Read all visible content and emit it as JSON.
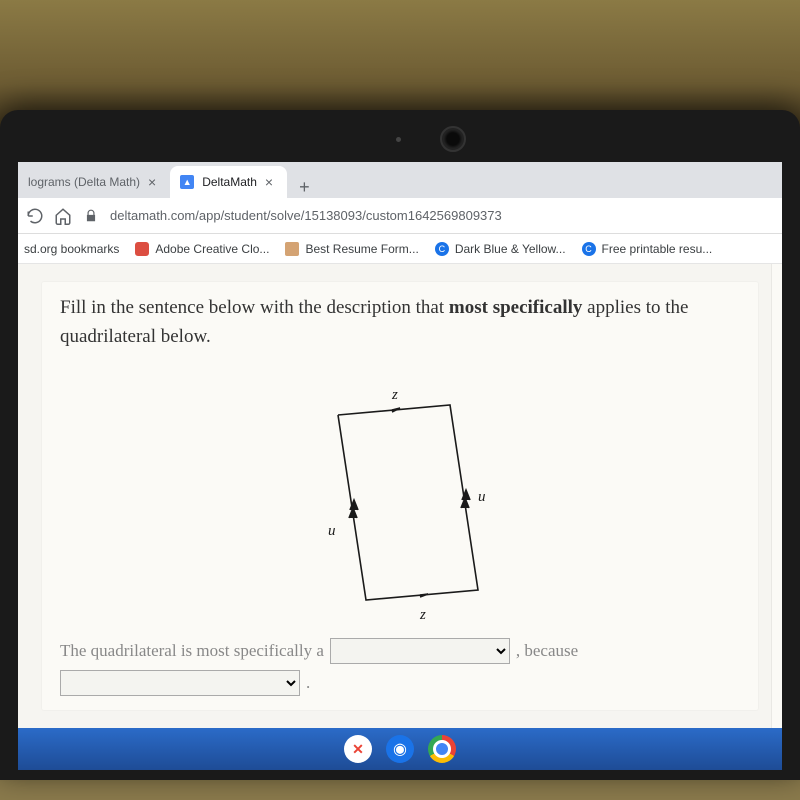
{
  "tabs": {
    "t1": {
      "label": "lograms (Delta Math)"
    },
    "t2": {
      "label": "DeltaMath"
    }
  },
  "url": "deltamath.com/app/student/solve/15138093/custom1642569809373",
  "bookmarks": {
    "b1": "sd.org bookmarks",
    "b2": "Adobe Creative Clo...",
    "b3": "Best Resume Form...",
    "b4": "Dark Blue & Yellow...",
    "b5": "Free printable resu..."
  },
  "question": {
    "lead": "Fill in the sentence below with the description that ",
    "emph": "most specifically",
    "tail": " applies to the quadrilateral below."
  },
  "labels": {
    "z": "z",
    "u": "u"
  },
  "answer": {
    "pre": "The quadrilateral is most specifically a",
    "mid": ", because",
    "end": "."
  }
}
